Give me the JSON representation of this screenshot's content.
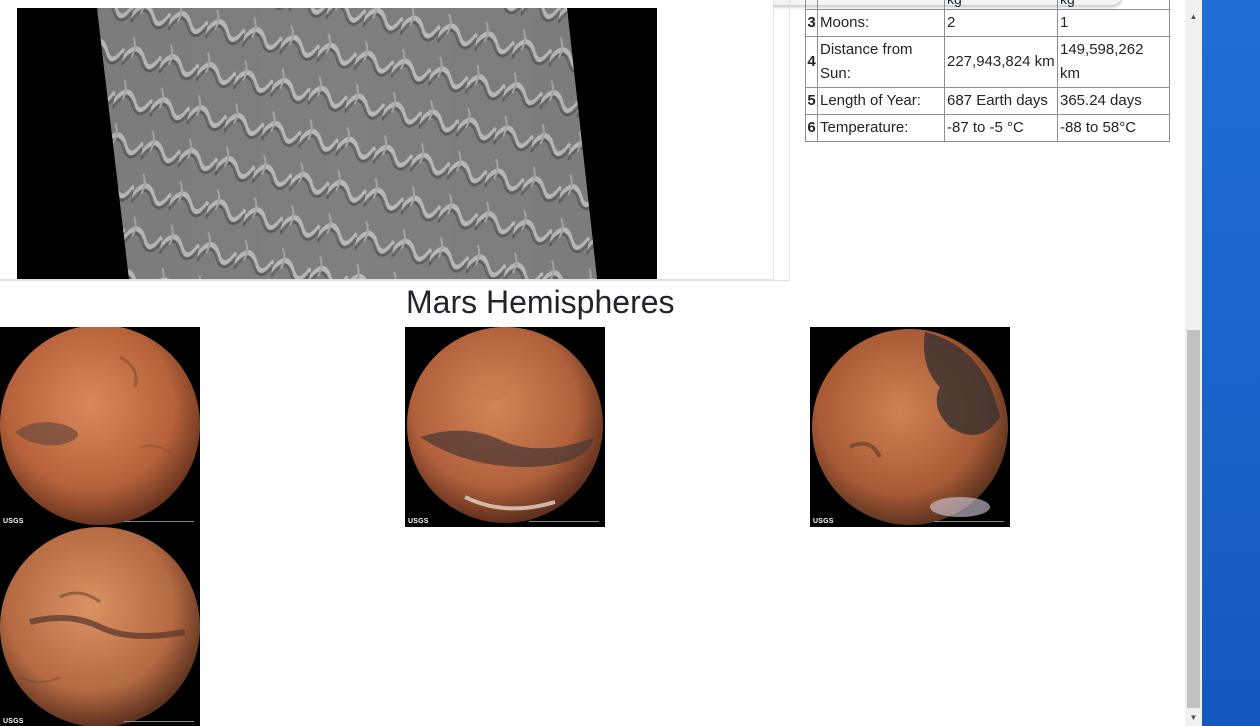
{
  "facts_table": {
    "partial_row": {
      "index": "",
      "description": "",
      "mars": "kg",
      "earth": "kg"
    },
    "rows": [
      {
        "index": "3",
        "description": "Moons:",
        "mars": "2",
        "earth": "1"
      },
      {
        "index": "4",
        "description": "Distance from Sun:",
        "mars": "227,943,824 km",
        "earth": "149,598,262 km"
      },
      {
        "index": "5",
        "description": "Length of Year:",
        "mars": "687 Earth days",
        "earth": "365.24 days"
      },
      {
        "index": "6",
        "description": "Temperature:",
        "mars": "-87 to -5 °C",
        "earth": "-88 to 58°C"
      }
    ]
  },
  "hemispheres": {
    "title": "Mars Hemispheres",
    "items": [
      {
        "logo_text": "USGS",
        "colors": {
          "base": "#b5623a",
          "dark": "#6e4a3a"
        }
      },
      {
        "logo_text": "USGS",
        "colors": {
          "base": "#b0603b",
          "dark": "#4f3a35"
        }
      },
      {
        "logo_text": "USGS",
        "colors": {
          "base": "#a85a36",
          "dark": "#3f3330"
        }
      },
      {
        "logo_text": "USGS",
        "colors": {
          "base": "#b46a42",
          "dark": "#5a3a2c"
        }
      }
    ]
  },
  "colors": {
    "desktop_blue": "#1a62c9",
    "scrollbar_track": "#f1f1f1",
    "scrollbar_thumb": "#c1c1c1"
  }
}
